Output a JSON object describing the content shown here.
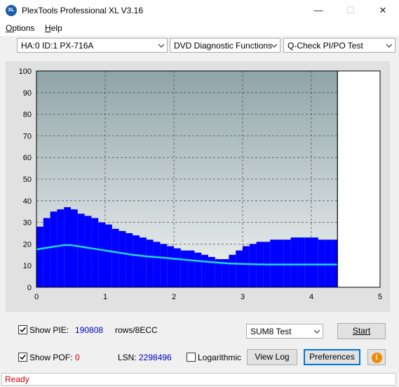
{
  "window": {
    "title": "PlexTools Professional XL V3.16",
    "icon_label": "XL",
    "minimize_glyph": "—",
    "maximize_glyph": "☐",
    "close_glyph": "✕"
  },
  "menu": [
    {
      "label": "Options",
      "mnemonic": "O",
      "rest": "ptions"
    },
    {
      "label": "Help",
      "mnemonic": "H",
      "rest": "elp"
    }
  ],
  "toolbar": {
    "drive": "HA:0 ID:1  PX-716A",
    "function": "DVD Diagnostic Functions",
    "test": "Q-Check PI/PO Test"
  },
  "chart_data": {
    "type": "area",
    "xlim": [
      0,
      5
    ],
    "ylim": [
      0,
      100
    ],
    "x_ticks": [
      "0",
      "1",
      "2",
      "3",
      "4",
      "5"
    ],
    "y_ticks": [
      "0",
      "10",
      "20",
      "30",
      "40",
      "50",
      "60",
      "70",
      "80",
      "90",
      "100"
    ],
    "grid": true,
    "end_marker_x": 4.38,
    "series": [
      {
        "type": "bar",
        "color": "#0000ff",
        "x": [
          0.0,
          0.1,
          0.2,
          0.3,
          0.4,
          0.5,
          0.6,
          0.7,
          0.8,
          0.9,
          1.0,
          1.1,
          1.2,
          1.3,
          1.4,
          1.5,
          1.6,
          1.7,
          1.8,
          1.9,
          2.0,
          2.1,
          2.2,
          2.3,
          2.4,
          2.5,
          2.6,
          2.7,
          2.8,
          2.9,
          3.0,
          3.1,
          3.2,
          3.3,
          3.4,
          3.5,
          3.6,
          3.7,
          3.8,
          3.9,
          4.0,
          4.1,
          4.2,
          4.3,
          4.38
        ],
        "values": [
          28,
          32,
          35,
          36,
          37,
          36,
          34,
          33,
          32,
          30,
          29,
          27,
          26,
          25,
          24,
          23,
          22,
          21,
          20,
          19,
          18,
          17,
          17,
          16,
          15,
          14,
          13,
          13,
          15,
          17,
          19,
          20,
          21,
          21,
          22,
          22,
          22,
          23,
          23,
          23,
          23,
          22,
          22,
          22,
          22
        ]
      },
      {
        "type": "line",
        "color": "#1fd8e6",
        "x": [
          0.0,
          0.2,
          0.4,
          0.5,
          0.6,
          0.8,
          1.0,
          1.2,
          1.4,
          1.6,
          1.8,
          2.0,
          2.2,
          2.4,
          2.6,
          2.8,
          3.0,
          3.2,
          3.4,
          3.6,
          3.8,
          4.0,
          4.2,
          4.38
        ],
        "values": [
          17.5,
          18.5,
          19.5,
          19.5,
          19.0,
          18.0,
          17.0,
          16.0,
          15.0,
          14.3,
          13.8,
          13.2,
          12.6,
          12.0,
          11.5,
          11.0,
          10.8,
          10.6,
          10.5,
          10.5,
          10.5,
          10.5,
          10.5,
          10.5
        ]
      }
    ]
  },
  "controls": {
    "show_pie_label": "Show PIE:",
    "pie_value": "190808",
    "rows_unit": "rows/8ECC",
    "show_pof_label": "Show POF:",
    "pof_value": "0",
    "lsn_label": "LSN:",
    "lsn_value": "2298496",
    "logarithmic_label": "Logarithmic",
    "test_mode": "SUM8 Test",
    "start_label": "Start",
    "view_log_label": "View Log",
    "preferences_label": "Preferences",
    "info_glyph": "i",
    "accent": "#0078d7",
    "info_color": "#f28a00",
    "pie_color": "#0000c0",
    "pof_color": "#d00000"
  },
  "status": {
    "text": "Ready"
  }
}
